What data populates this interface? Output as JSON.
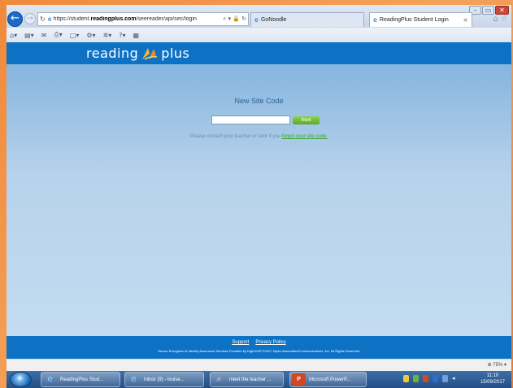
{
  "browser": {
    "url_prefix": "https://student.",
    "url_domain": "readingplus.com",
    "url_path": "/seereader/api/sec/login",
    "tabs": [
      {
        "label": "GoNoodle"
      },
      {
        "label": "ReadingPlus Student Login"
      }
    ],
    "window_controls": [
      "–",
      "▭",
      "✕"
    ],
    "zoom": "75%"
  },
  "site": {
    "logo_left": "reading",
    "logo_right": "plus",
    "heading": "New Site Code",
    "input_value": "",
    "next_label": "Next",
    "help_text": "Please contact your teacher or tutor if you",
    "help_link": "forgot your site code.",
    "footer_links": [
      "Support",
      "Privacy Policy"
    ],
    "footer_legal": "Secure Encryption & Identity Assurance Services Provided by DigiCert® ©2017 Taylor Associates/Communications, Inc. All Rights Reserved.",
    "brand_blue": "#0e72c4",
    "accent_green": "#5aa92a"
  },
  "taskbar": {
    "tasks": [
      {
        "label": "ReadingPlus Stud...",
        "icon": "ie-icon"
      },
      {
        "label": "Inbox (9) - louise...",
        "icon": "ie-icon"
      },
      {
        "label": "meet the teacher ...",
        "icon": "search-icon"
      },
      {
        "label": "Microsoft PowerP...",
        "icon": "powerpoint-icon"
      }
    ],
    "time": "11:10",
    "date": "15/09/2017"
  }
}
